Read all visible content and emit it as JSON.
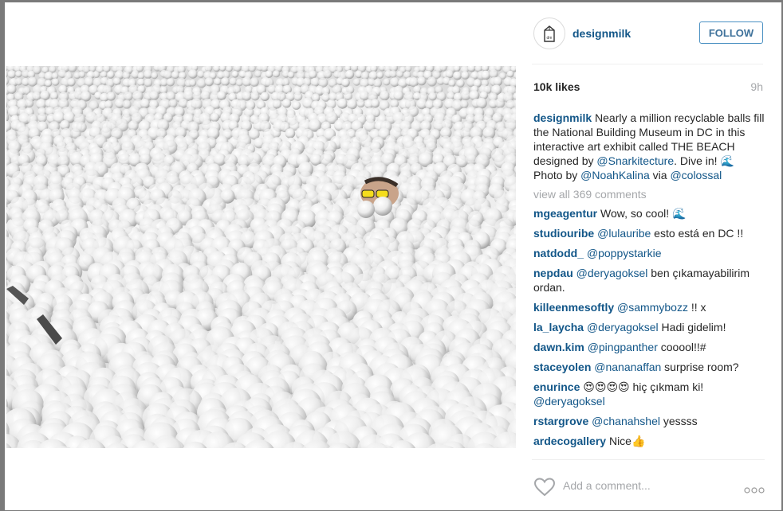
{
  "post": {
    "author": "designmilk",
    "follow_label": "FOLLOW",
    "likes": "10k likes",
    "time_ago": "9h",
    "avatar_icon": "milk-carton-icon",
    "avatar_text": "dm",
    "caption": {
      "user": "designmilk",
      "part1": " Nearly a million recyclable balls fill the National Building Museum in DC in this interactive art exhibit called THE BEACH designed by ",
      "mention1": "@Snarkitecture",
      "part2": ". Dive in! 🌊 Photo by ",
      "mention2": "@NoahKalina",
      "part3": " via ",
      "mention3": "@colossal"
    },
    "view_all": "view all 369 comments",
    "comments": [
      {
        "user": "mgeagentur",
        "text": " Wow, so cool! 🌊"
      },
      {
        "user": "studiouribe",
        "mention": "@lulauribe",
        "text": " esto está en DC !!"
      },
      {
        "user": "natdodd_",
        "mention": "@poppystarkie",
        "text": ""
      },
      {
        "user": "nepdau",
        "mention": "@deryagoksel",
        "text": " ben çıkamayabilirim ordan."
      },
      {
        "user": "killeenmesoftly",
        "mention": "@sammybozz",
        "text": " !! x"
      },
      {
        "user": "la_laycha",
        "mention": "@deryagoksel",
        "text": " Hadi gidelim!"
      },
      {
        "user": "dawn.kim",
        "mention": "@pingpanther",
        "text": " cooool!!#"
      },
      {
        "user": "staceyolen",
        "mention": "@nananaffan",
        "text": " surprise room?"
      },
      {
        "user": "enurince",
        "text": " 😍😍😍😍 hiç çıkmam ki! ",
        "mention_after": "@deryagoksel"
      },
      {
        "user": "rstargrove",
        "mention": "@chanahshel",
        "text": " yessss"
      },
      {
        "user": "ardecogallery",
        "text": " Nice👍"
      }
    ],
    "add_comment_placeholder": "Add a comment...",
    "heart_icon": "heart-outline-icon",
    "more_icon": "more-options-icon"
  }
}
